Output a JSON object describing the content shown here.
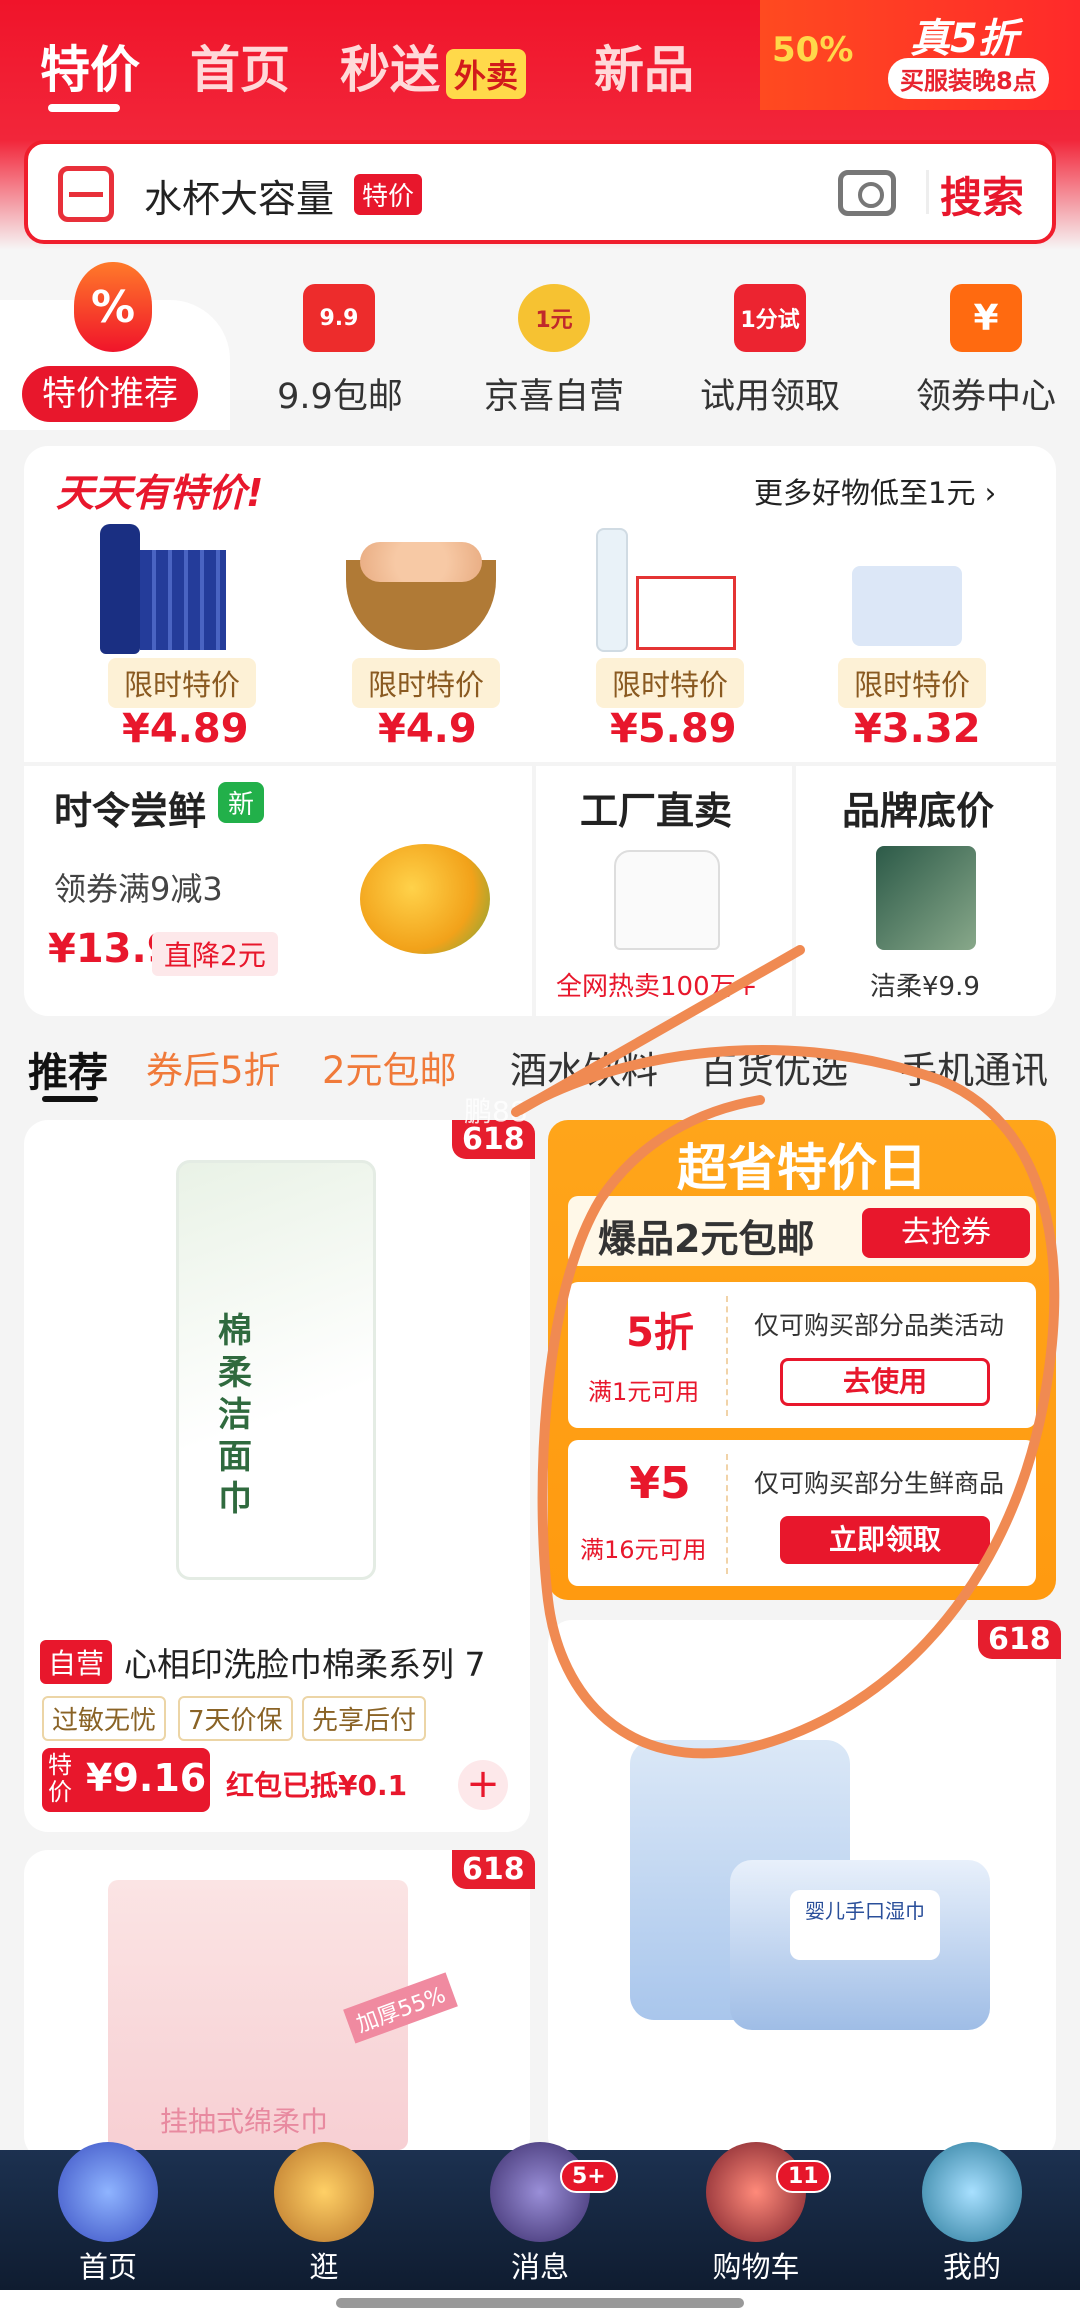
{
  "top_nav": {
    "tabs": [
      "特价",
      "首页",
      "秒送",
      "新品"
    ],
    "waimai_badge": "外卖",
    "promo": {
      "percent": "50%",
      "headline": "真5折",
      "sub": "买服装晚8点"
    }
  },
  "search": {
    "query": "水杯大容量",
    "tag": "特价",
    "button": "搜索"
  },
  "categories": [
    {
      "label": "特价推荐",
      "icon": "percent-flame-icon"
    },
    {
      "label": "9.9包邮",
      "icon_text": "9.9"
    },
    {
      "label": "京喜自营",
      "icon_text": "1元"
    },
    {
      "label": "试用领取",
      "icon_text": "1分试"
    },
    {
      "label": "领券中心",
      "icon_text": "¥"
    }
  ],
  "daily": {
    "title": "天天有特价!",
    "more": "更多好物低至1元",
    "items": [
      {
        "badge": "限时特价",
        "price": "¥4.89",
        "image": "pepsi-icon"
      },
      {
        "badge": "限时特价",
        "price": "¥4.9",
        "image": "eggs-basket-icon"
      },
      {
        "badge": "限时特价",
        "price": "¥5.89",
        "image": "water-bottle-icon"
      },
      {
        "badge": "限时特价",
        "price": "¥3.32",
        "image": "tissue-box-icon"
      }
    ]
  },
  "fresh": {
    "title": "时令尝鲜",
    "new_badge": "新",
    "coupon": "领券满9减3",
    "price": "¥13.9",
    "drop": "直降2元"
  },
  "factory": {
    "title": "工厂直卖",
    "note": "全网热卖100万+"
  },
  "brand": {
    "title": "品牌底价",
    "note": "洁柔¥9.9"
  },
  "rec_tabs": [
    "推荐",
    "券后5折",
    "2元包邮",
    "酒水饮料",
    "百货优选",
    "手机通讯"
  ],
  "watermark": "鹏88",
  "product1": {
    "tag_618": "618",
    "self_run": "自营",
    "title": "心相印洗脸巾棉柔系列 7",
    "features": [
      "过敏无忧",
      "7天价保",
      "先享后付"
    ],
    "special": "特价",
    "price": "¥9.16",
    "redpacket": "红包已抵¥0.1",
    "pack_text": "棉柔洁面巾"
  },
  "coupon_panel": {
    "title": "超省特价日",
    "sub": "爆品2元包邮",
    "grab": "去抢券",
    "coupons": [
      {
        "value": "5折",
        "cond": "满1元可用",
        "desc": "仅可购买部分品类活动",
        "btn": "去使用"
      },
      {
        "value": "¥5",
        "cond": "满16元可用",
        "desc": "仅可购买部分生鲜商品",
        "btn": "立即领取"
      }
    ]
  },
  "product2": {
    "tag_618": "618",
    "pack_text": "婴儿手口湿巾"
  },
  "product3": {
    "tag_618": "618",
    "pack_text": "挂抽式绵柔巾",
    "pack_badge": "加厚55%"
  },
  "bottom_nav": [
    {
      "label": "首页",
      "count": ""
    },
    {
      "label": "逛",
      "count": ""
    },
    {
      "label": "消息",
      "count": "5+"
    },
    {
      "label": "购物车",
      "count": "11"
    },
    {
      "label": "我的",
      "count": ""
    }
  ],
  "colors": {
    "brand_red": "#f0142a",
    "annotation_orange": "#f08a52"
  }
}
